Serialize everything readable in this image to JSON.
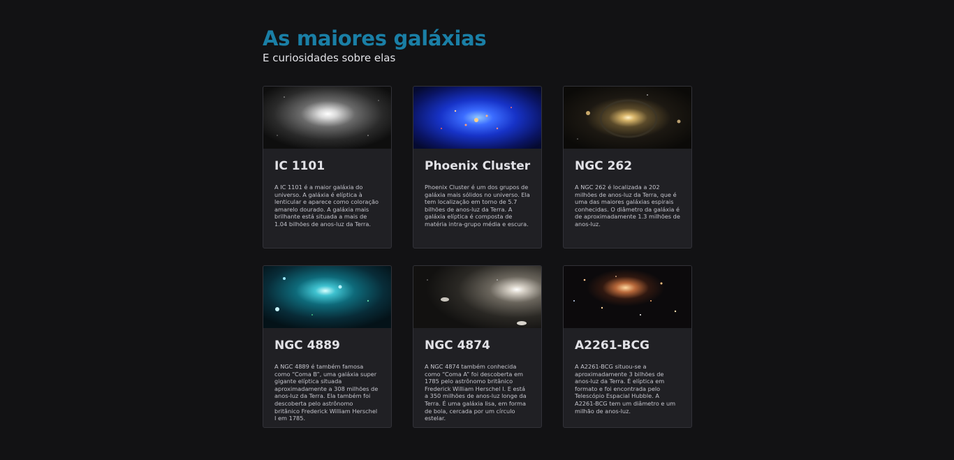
{
  "header": {
    "title": "As maiores galáxias",
    "subtitle": "E curiosidades sobre elas"
  },
  "cards": [
    {
      "name": "IC 1101",
      "description": "A IC 1101 é a maior galáxia do universo. A galáxia é elíptica à lenticular e aparece como coloração amarelo dourado. A galáxia mais brilhante está situada a mais de 1.04 bilhões de anos-luz da Terra."
    },
    {
      "name": "Phoenix Cluster",
      "description": "Phoenix Cluster é um dos grupos de galáxia mais sólidos no universo. Ela tem localização em torno de 5.7 bilhões de anos-luz da Terra. A galáxia elíptica é composta de matéria intra-grupo média e escura."
    },
    {
      "name": "NGC 262",
      "description": "A NGC 262 é localizada a 202 milhões de anos-luz da Terra, que é uma das maiores galáxias espirais conhecidas. O diâmetro da galáxia é de aproximadamente 1.3 milhões de anos-luz."
    },
    {
      "name": "NGC 4889",
      "description": "A NGC 4889 é também famosa como “Coma B”, uma galáxia super gigante elíptica situada aproximadamente a 308 milhões de anos-luz da Terra. Ela também foi descoberta pelo astrônomo britânico Frederick William Herschel I em 1785."
    },
    {
      "name": "NGC 4874",
      "description": "A NGC 4874 também conhecida como “Coma A” foi descoberta em 1785 pelo astrônomo britânico Frederick William Herschel I. E está a 350 milhões de anos-luz longe da Terra. É uma galáxia lisa, em forma de bola, cercada por um círculo estelar."
    },
    {
      "name": "A2261-BCG",
      "description": "A A2261-BCG situou-se a aproximadamente 3 bilhões de anos-luz da Terra. É elíptica em formato e foi encontrada pelo Telescópio Espacial Hubble. A A2261-BCG tem um diâmetro e um milhão de anos-luz."
    }
  ],
  "colors": {
    "background": "#121214",
    "card": "#202024",
    "accent": "#1a7fa6"
  }
}
